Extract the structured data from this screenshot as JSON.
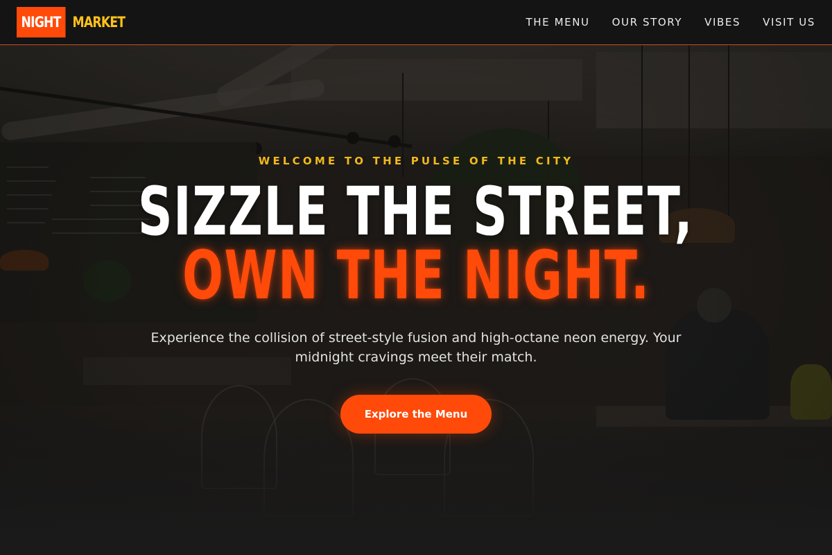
{
  "brand": {
    "logo_part1": "NIGHT",
    "logo_part2": "MARKET",
    "colors": {
      "primary": "#ff4a0a",
      "accent": "#ffc21a",
      "nav_bg": "#141414"
    }
  },
  "nav": {
    "items": [
      {
        "label": "THE MENU"
      },
      {
        "label": "OUR STORY"
      },
      {
        "label": "VIBES"
      },
      {
        "label": "VISIT US"
      }
    ]
  },
  "hero": {
    "tagline": "WELCOME TO THE PULSE OF THE CITY",
    "headline_line1": "SIZZLE THE STREET,",
    "headline_line2": "OWN THE NIGHT.",
    "description": "Experience the collision of street-style fusion and high-octane neon energy. Your midnight cravings meet their match.",
    "cta_label": "Explore the Menu"
  }
}
